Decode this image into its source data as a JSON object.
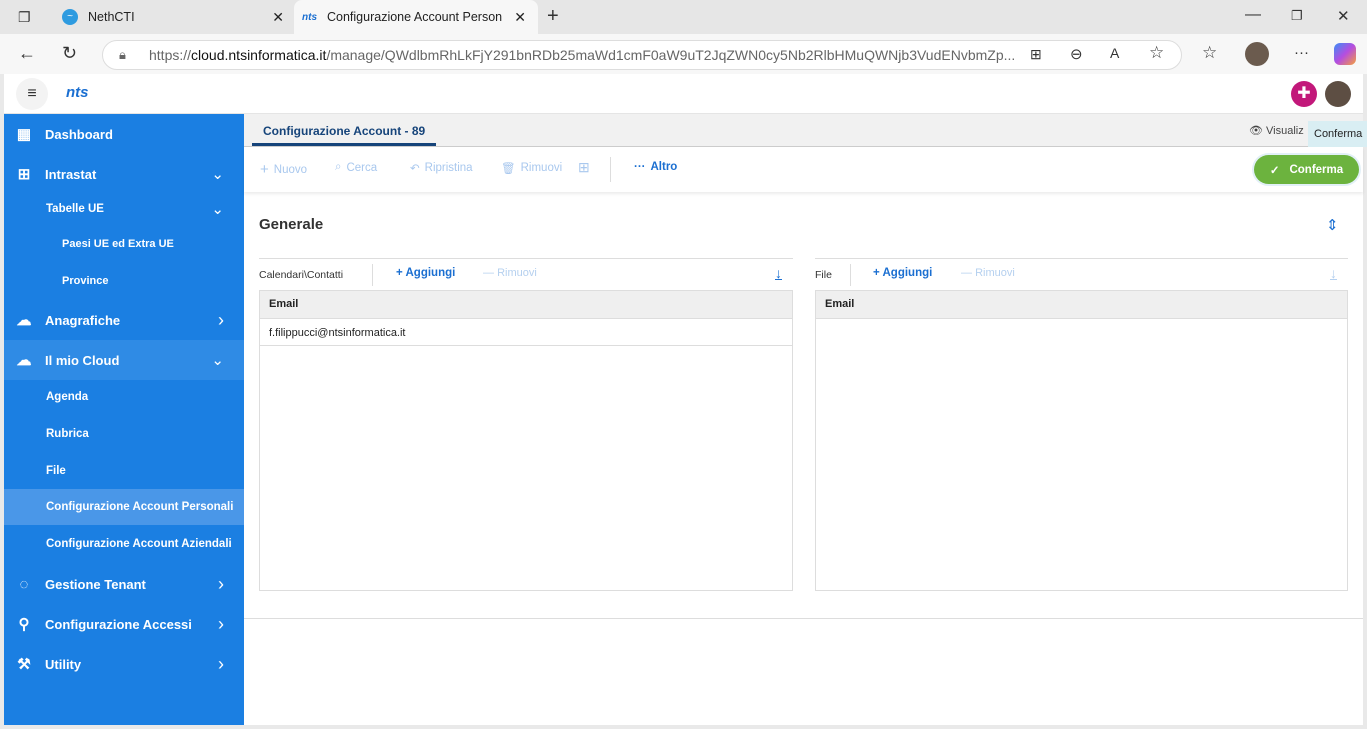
{
  "browser": {
    "tabs": [
      {
        "title": "NethCTI"
      },
      {
        "title": "Configurazione Account Personali"
      }
    ],
    "url_prefix": "https://",
    "url_domain": "cloud.ntsinformatica.it",
    "url_rest": "/manage/QWdlbmRhLkFjY291bnRDb25maWd1cmF0aW9uT2JqZWN0cy5Nb2RlbHMuQWNjb3VudENvbmZp..."
  },
  "app": {
    "logo": "nts"
  },
  "sidebar": {
    "items": [
      {
        "label": "Dashboard",
        "icon": "dashboard-icon"
      },
      {
        "label": "Intrastat",
        "icon": "table-icon",
        "chevron": "down"
      },
      {
        "label": "Tabelle UE",
        "chevron": "down"
      },
      {
        "label": "Paesi UE ed Extra UE"
      },
      {
        "label": "Province"
      },
      {
        "label": "Anagrafiche",
        "icon": "people-icon",
        "chevron": "right"
      },
      {
        "label": "Il mio Cloud",
        "icon": "cloud-icon",
        "chevron": "down"
      },
      {
        "label": "Agenda"
      },
      {
        "label": "Rubrica"
      },
      {
        "label": "File"
      },
      {
        "label": "Configurazione Account Personali",
        "selected": true
      },
      {
        "label": "Configurazione Account Aziendali"
      },
      {
        "label": "Gestione Tenant",
        "icon": "bulb-icon",
        "chevron": "right"
      },
      {
        "label": "Configurazione Accessi",
        "icon": "user-key-icon",
        "chevron": "right"
      },
      {
        "label": "Utility",
        "icon": "wrench-icon",
        "chevron": "right"
      }
    ]
  },
  "main": {
    "tab": "Configurazione Account - 89",
    "view_label": "Visualiz",
    "tooltip": "Conferma",
    "toolbar": {
      "new": "Nuovo",
      "search": "Cerca",
      "restore": "Ripristina",
      "remove": "Rimuovi",
      "more": "Altro",
      "confirm": "Conferma"
    },
    "section_title": "Generale",
    "left_panel": {
      "label": "Calendari\\Contatti",
      "add": "Aggiungi",
      "remove": "Rimuovi",
      "column": "Email",
      "rows": [
        "f.filippucci@ntsinformatica.it"
      ]
    },
    "right_panel": {
      "label": "File",
      "add": "Aggiungi",
      "remove": "Rimuovi",
      "column": "Email",
      "rows": []
    }
  },
  "colors": {
    "sidebar": "#1b7fe2",
    "accent": "#1b6fd1",
    "confirm": "#6cb33e"
  }
}
